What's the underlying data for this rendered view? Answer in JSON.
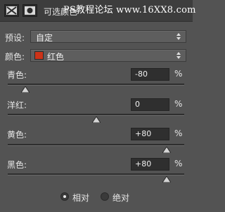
{
  "panel": {
    "title": "可选颜色",
    "watermark": "PS教程论坛 www.16XX8.com"
  },
  "preset": {
    "label": "预设:",
    "value": "自定"
  },
  "colors": {
    "label": "颜色:",
    "value": "红色",
    "swatch": "#cc3318"
  },
  "sliders": [
    {
      "label": "青色:",
      "value": "-80",
      "level": -80,
      "unit": "%"
    },
    {
      "label": "洋红:",
      "value": "0",
      "level": 0,
      "unit": "%"
    },
    {
      "label": "黄色:",
      "value": "+80",
      "level": 80,
      "unit": "%"
    },
    {
      "label": "黑色:",
      "value": "+80",
      "level": 80,
      "unit": "%"
    }
  ],
  "method": {
    "options": [
      {
        "label": "相对",
        "selected": true
      },
      {
        "label": "绝对",
        "selected": false
      }
    ]
  }
}
